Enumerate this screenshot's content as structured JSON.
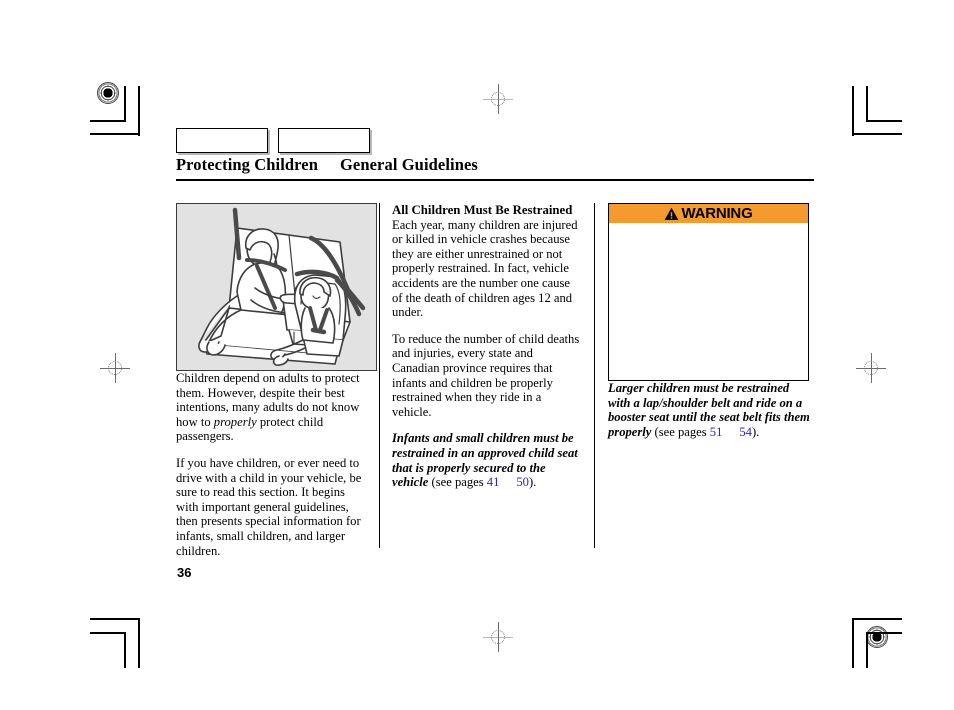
{
  "document": {
    "page_number": "36",
    "section_title": "Protecting Children",
    "subsection_title": "General Guidelines"
  },
  "tabs": [
    {
      "label": ""
    },
    {
      "label": ""
    }
  ],
  "left_column": {
    "illustration_alt": "Woman and two children restrained in child seats on rear bench seat",
    "paragraphs": [
      "Children depend on adults to protect them. However, despite their best intentions, many adults do not know how to ",
      "If you have children, or ever need to drive with a child in your vehicle, be sure to read this section. It begins with important general guidelines, then presents special information for infants, small children, and larger children."
    ],
    "paragraph1_italic": "properly",
    "paragraph1_tail": " protect child passengers."
  },
  "middle_column": {
    "heading": "All Children Must Be Restrained",
    "paragraph1": "Each year, many children are injured or killed in vehicle crashes because they are either unrestrained or not properly restrained. In fact, vehicle accidents are the number one cause of the death of children ages 12 and under.",
    "paragraph2": "To reduce the number of child deaths and injuries, every state and Canadian province requires that infants and children be properly restrained when they ride in a vehicle.",
    "emphasis": "Infants and small children must be restrained in an approved child seat that is properly secured to the vehicle",
    "see_pages_prefix": " (see pages ",
    "page_link_1": "41",
    "page_link_2": "50",
    "see_pages_suffix": ")."
  },
  "right_column": {
    "warning": {
      "icon": "warning-triangle-icon",
      "title": "WARNING",
      "body_text": ""
    },
    "emphasis": "Larger children must be restrained with a lap/shoulder belt and ride on a booster seat until the seat belt fits them properly",
    "see_pages_prefix": " (see pages ",
    "page_link_1": "51",
    "page_link_2": "54",
    "see_pages_suffix": ")."
  },
  "colors": {
    "warning_orange": "#f59a2e",
    "link_blue": "#2323d8",
    "illustration_background": "#e2e2e2"
  }
}
